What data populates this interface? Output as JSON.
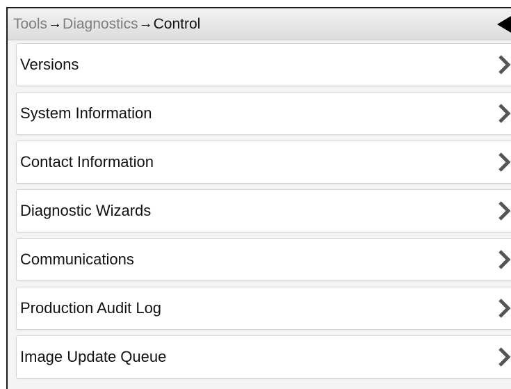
{
  "header": {
    "breadcrumb": [
      "Tools",
      "Diagnostics",
      "Control"
    ],
    "separator": "→",
    "back_icon": "back-triangle-icon"
  },
  "menu": {
    "items": [
      {
        "label": "Versions",
        "icon": "chevron-right-icon"
      },
      {
        "label": "System Information",
        "icon": "chevron-right-icon"
      },
      {
        "label": "Contact Information",
        "icon": "chevron-right-icon"
      },
      {
        "label": "Diagnostic Wizards",
        "icon": "chevron-right-icon"
      },
      {
        "label": "Communications",
        "icon": "chevron-right-icon"
      },
      {
        "label": "Production Audit Log",
        "icon": "chevron-right-icon"
      },
      {
        "label": "Image Update Queue",
        "icon": "chevron-right-icon"
      }
    ]
  },
  "colors": {
    "text": "#111111",
    "breadcrumb_muted": "#7e7e7e",
    "chevron": "#555555",
    "back_triangle": "#000000"
  }
}
